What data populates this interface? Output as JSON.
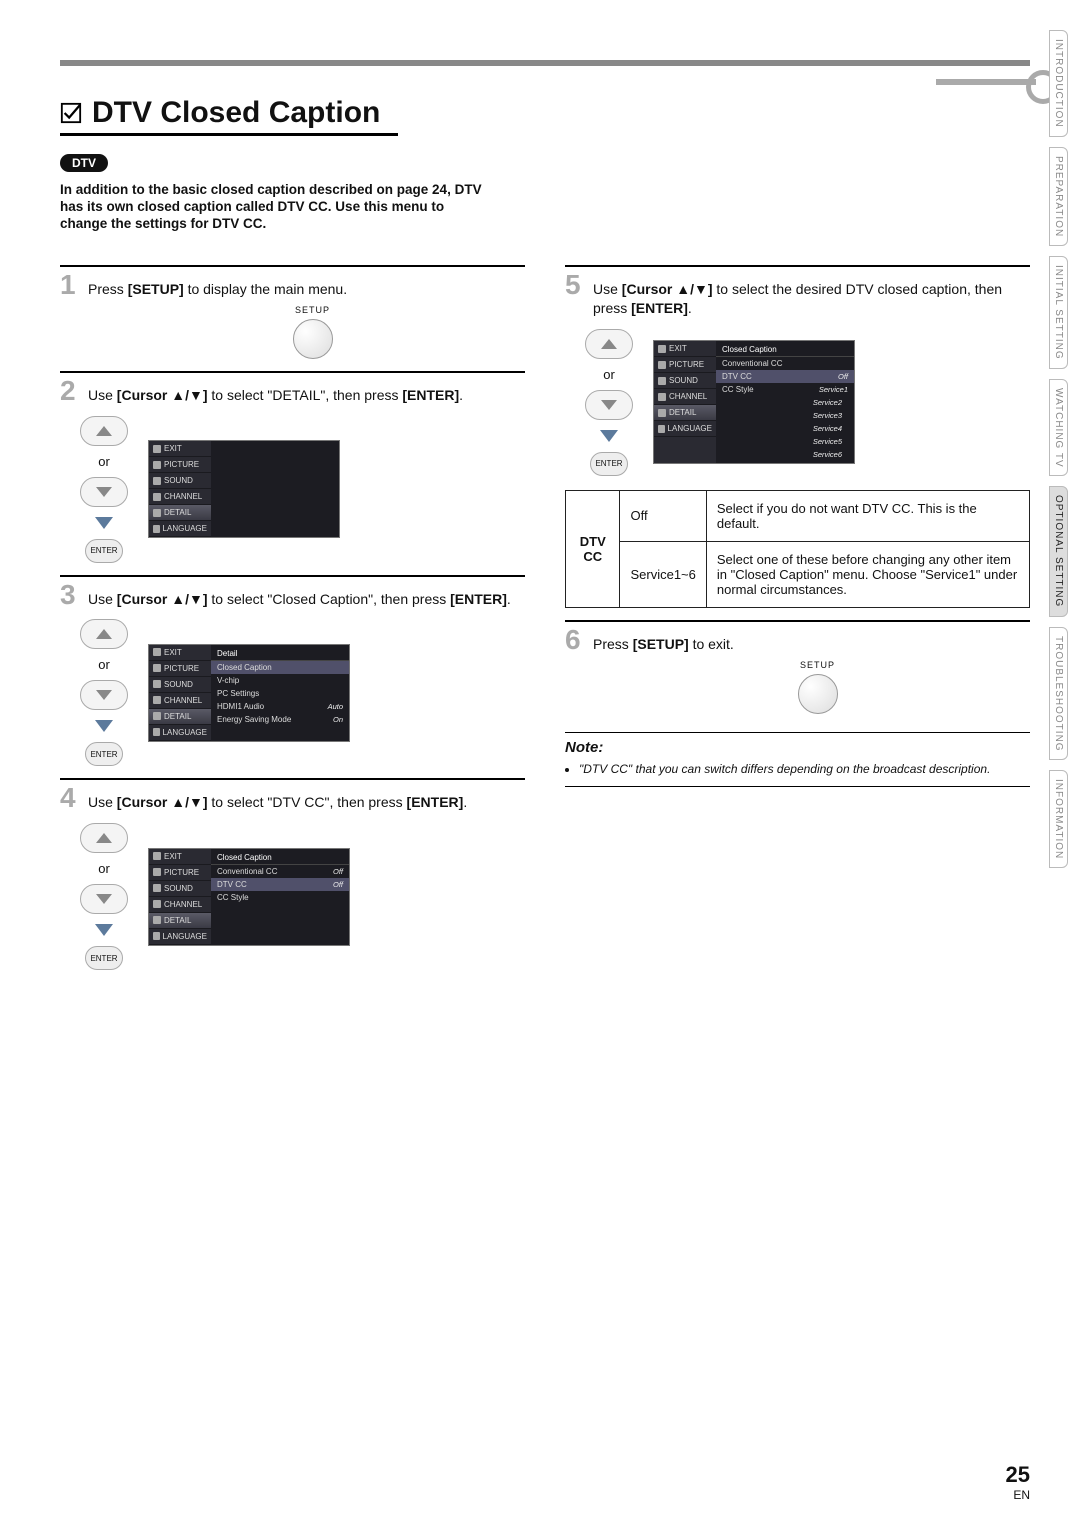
{
  "page_title": "DTV Closed Caption",
  "dtv_badge": "DTV",
  "intro": "In addition to the basic closed caption described on page 24, DTV has its own closed caption called DTV CC. Use this menu to change the settings for DTV CC.",
  "steps": {
    "s1": {
      "num": "1",
      "pre": "Press ",
      "b1": "[SETUP]",
      "post": " to display the main menu."
    },
    "s2": {
      "num": "2",
      "pre": "Use ",
      "b1": "[Cursor ▲/▼]",
      "mid": " to select \"DETAIL\", then press ",
      "b2": "[ENTER]",
      "post": "."
    },
    "s3": {
      "num": "3",
      "pre": "Use ",
      "b1": "[Cursor ▲/▼]",
      "mid": " to select \"Closed Caption\", then press ",
      "b2": "[ENTER]",
      "post": "."
    },
    "s4": {
      "num": "4",
      "pre": "Use ",
      "b1": "[Cursor ▲/▼]",
      "mid": " to select \"DTV CC\", then press ",
      "b2": "[ENTER]",
      "post": "."
    },
    "s5": {
      "num": "5",
      "pre": "Use ",
      "b1": "[Cursor ▲/▼]",
      "mid": " to select the desired DTV closed caption, then press ",
      "b2": "[ENTER]",
      "post": "."
    },
    "s6": {
      "num": "6",
      "pre": "Press ",
      "b1": "[SETUP]",
      "post": " to exit."
    }
  },
  "setup_label": "SETUP",
  "or_label": "or",
  "enter_label": "ENTER",
  "menu_side": {
    "exit": "EXIT",
    "picture": "PICTURE",
    "sound": "SOUND",
    "channel": "CHANNEL",
    "detail": "DETAIL",
    "language": "LANGUAGE"
  },
  "menu_step3": {
    "title": "Detail",
    "items": [
      {
        "label": "Closed Caption",
        "val": "",
        "sel": true
      },
      {
        "label": "V-chip",
        "val": ""
      },
      {
        "label": "PC Settings",
        "val": ""
      },
      {
        "label": "HDMI1 Audio",
        "val": "Auto"
      },
      {
        "label": "Energy Saving Mode",
        "val": "On"
      }
    ]
  },
  "menu_step4": {
    "title": "Closed Caption",
    "items": [
      {
        "label": "Conventional CC",
        "val": "Off"
      },
      {
        "label": "DTV CC",
        "val": "Off",
        "sel": true
      },
      {
        "label": "CC Style",
        "val": ""
      }
    ]
  },
  "menu_step5": {
    "title": "Closed Caption",
    "items": [
      {
        "label": "Conventional CC",
        "val": ""
      },
      {
        "label": "DTV CC",
        "val": "Off",
        "sel": true
      },
      {
        "label": "CC Style",
        "val": "Service1"
      }
    ],
    "options": [
      "Service2",
      "Service3",
      "Service4",
      "Service5",
      "Service6"
    ]
  },
  "option_table": {
    "header": "DTV CC",
    "rows": [
      {
        "opt": "Off",
        "desc": "Select if you do not want DTV CC. This is the default."
      },
      {
        "opt": "Service1~6",
        "desc": "Select one of these before changing any other item in \"Closed Caption\" menu. Choose \"Service1\" under normal circumstances."
      }
    ]
  },
  "note": {
    "title": "Note:",
    "body": "\"DTV CC\" that you can switch differs depending on the broadcast description."
  },
  "side_tabs": [
    "INTRODUCTION",
    "PREPARATION",
    "INITIAL SETTING",
    "WATCHING TV",
    "OPTIONAL SETTING",
    "TROUBLESHOOTING",
    "INFORMATION"
  ],
  "side_tab_active_index": 4,
  "footer": {
    "page": "25",
    "lang": "EN"
  }
}
